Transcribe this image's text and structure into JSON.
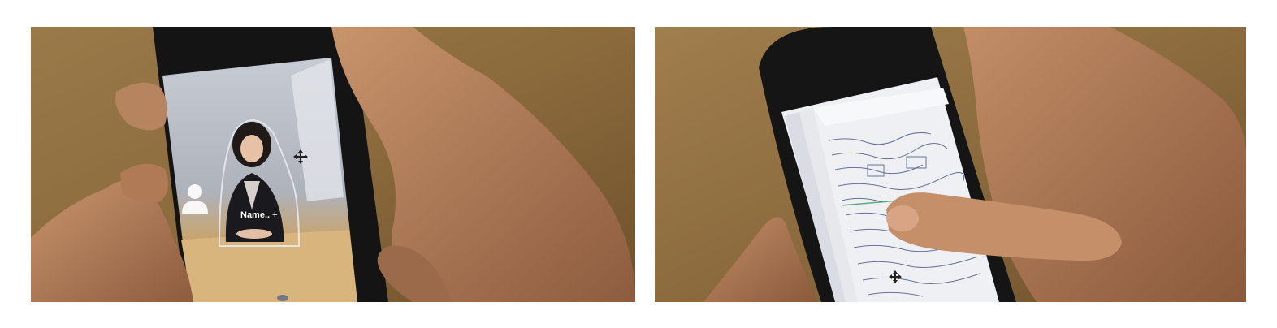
{
  "left_photo": {
    "name_tag": "Name.. +",
    "icons": [
      "person-silhouette-icon",
      "move-cross-icon"
    ]
  },
  "right_photo": {
    "icons": [
      "move-cross-icon"
    ]
  },
  "colors": {
    "wood": "#8a6a3f",
    "phone_body": "#151515",
    "skin": "#b57f5c",
    "screen_paper": "#eef0f3"
  }
}
